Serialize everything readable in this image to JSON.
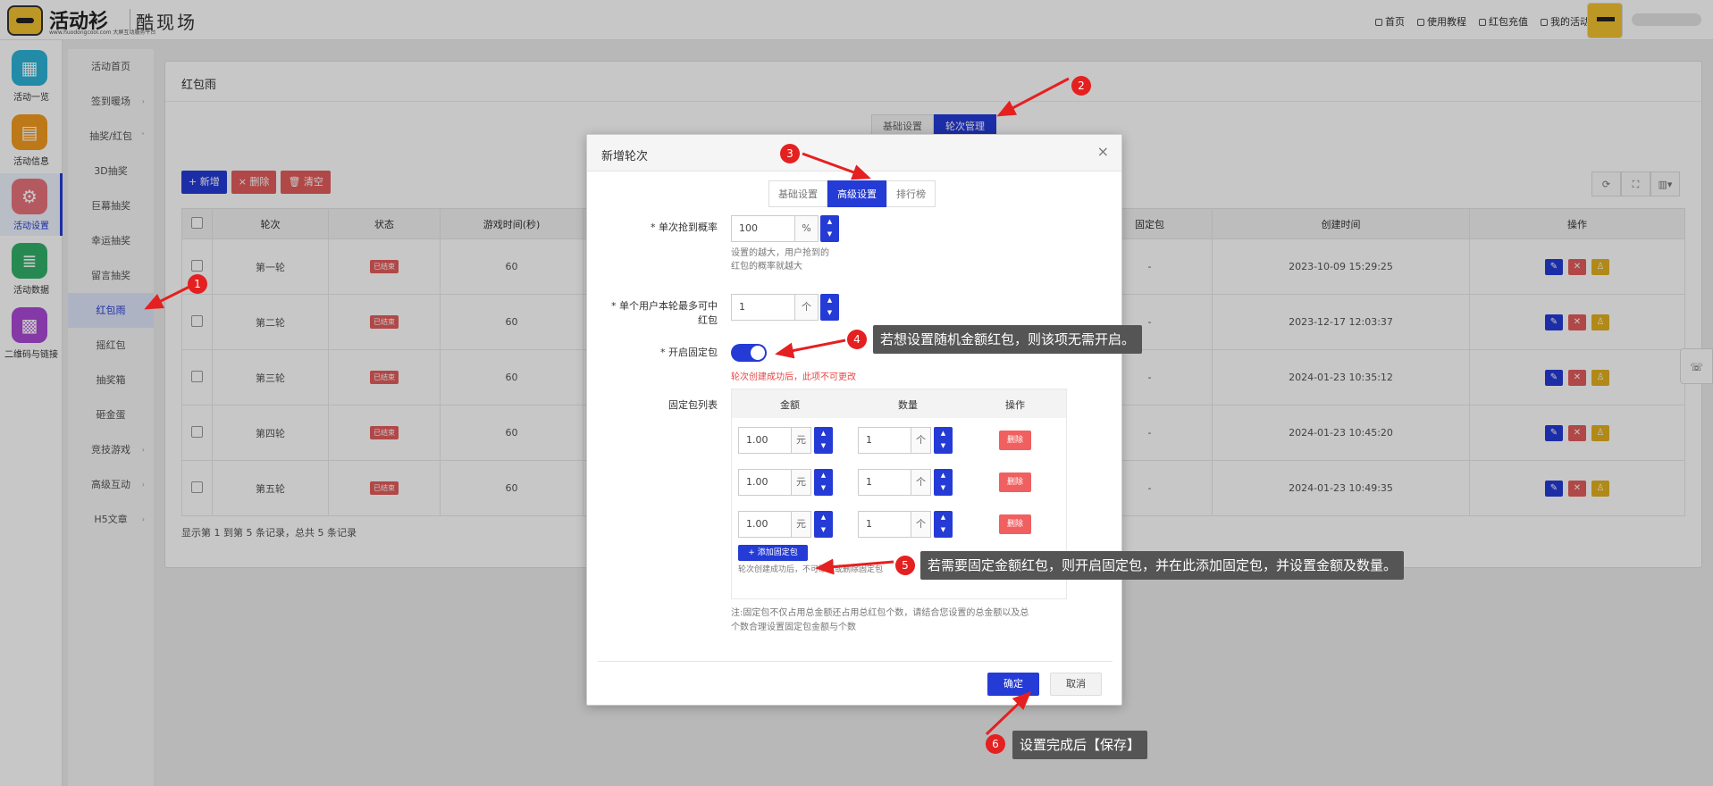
{
  "topbar": {
    "brand": "活动衫",
    "brand_sub": "www.huodongcool.com  大屏互动服务平台",
    "brand2": "酷现场",
    "nav": [
      "首页",
      "使用教程",
      "红包充值",
      "我的活动"
    ],
    "avatar_label": "活动衫"
  },
  "leftbar": [
    {
      "label": "活动一览",
      "icon": "grid-icon",
      "color": "#2cb3d6"
    },
    {
      "label": "活动信息",
      "icon": "document-icon",
      "color": "#f39a1f"
    },
    {
      "label": "活动设置",
      "icon": "gear-icon",
      "color": "#e8737c"
    },
    {
      "label": "活动数据",
      "icon": "database-icon",
      "color": "#33b06a"
    },
    {
      "label": "二维码与链接",
      "icon": "qrcode-icon",
      "color": "#a94ad6"
    }
  ],
  "subnav": [
    "活动首页",
    "签到暖场",
    "抽奖/红包",
    "3D抽奖",
    "巨幕抽奖",
    "幸运抽奖",
    "留言抽奖",
    "红包雨",
    "摇红包",
    "抽奖箱",
    "砸金蛋",
    "竞技游戏",
    "高级互动",
    "H5文章"
  ],
  "panel": {
    "title": "红包雨",
    "tabs": [
      "基础设置",
      "轮次管理"
    ],
    "toolbar": {
      "add": "+ 新增",
      "delete": "× 删除",
      "clear": "🗑 清空"
    },
    "columns": [
      "轮次",
      "状态",
      "游戏时间(秒)",
      "固定包",
      "创建时间",
      "操作"
    ],
    "rows": [
      {
        "round": "第一轮",
        "status": "已结束",
        "time": "60",
        "fixed": "-",
        "created": "2023-10-09 15:29:25"
      },
      {
        "round": "第二轮",
        "status": "已结束",
        "time": "60",
        "fixed": "-",
        "created": "2023-12-17 12:03:37"
      },
      {
        "round": "第三轮",
        "status": "已结束",
        "time": "60",
        "fixed": "-",
        "created": "2024-01-23 10:35:12"
      },
      {
        "round": "第四轮",
        "status": "已结束",
        "time": "60",
        "fixed": "-",
        "created": "2024-01-23 10:45:20"
      },
      {
        "round": "第五轮",
        "status": "已结束",
        "time": "60",
        "fixed": "-",
        "created": "2024-01-23 10:49:35"
      }
    ],
    "footnote": "显示第 1 到第 5 条记录，总共 5 条记录"
  },
  "modal": {
    "title": "新增轮次",
    "tabs": [
      "基础设置",
      "高级设置",
      "排行榜"
    ],
    "prob_label": "* 单次抢到概率",
    "prob_value": "100",
    "prob_unit": "%",
    "prob_hint1": "设置的越大，用户抢到的",
    "prob_hint2": "红包的概率就越大",
    "max_label1": "* 单个用户本轮最多可中",
    "max_label2": "红包",
    "max_value": "1",
    "max_unit": "个",
    "fixed_label": "* 开启固定包",
    "fixed_warn": "轮次创建成功后，此项不可更改",
    "list_label": "固定包列表",
    "list_cols": [
      "金额",
      "数量",
      "操作"
    ],
    "list_rows": [
      {
        "amount": "1.00",
        "amount_unit": "元",
        "qty": "1",
        "qty_unit": "个",
        "del": "删除"
      },
      {
        "amount": "1.00",
        "amount_unit": "元",
        "qty": "1",
        "qty_unit": "个",
        "del": "删除"
      },
      {
        "amount": "1.00",
        "amount_unit": "元",
        "qty": "1",
        "qty_unit": "个",
        "del": "删除"
      }
    ],
    "add_btn": "+ 添加固定包",
    "add_hint": "轮次创建成功后，不可添加或删除固定包",
    "note1": "注:固定包不仅占用总金额还占用总红包个数，请结合您设置的总金额以及总",
    "note2": "个数合理设置固定包金额与个数",
    "ok": "确定",
    "cancel": "取消"
  },
  "annotations": {
    "n1": "1",
    "n2": "2",
    "n3": "3",
    "n4": "4",
    "n5": "5",
    "n6": "6",
    "tip4": "若想设置随机金额红包，则该项无需开启。",
    "tip5": "若需要固定金额红包，则开启固定包，并在此添加固定包，并设置金额及数量。",
    "tip6": "设置完成后【保存】"
  },
  "colors": {
    "accent": "#253bd6",
    "danger": "#e35d5d",
    "annotation": "#e52020"
  }
}
